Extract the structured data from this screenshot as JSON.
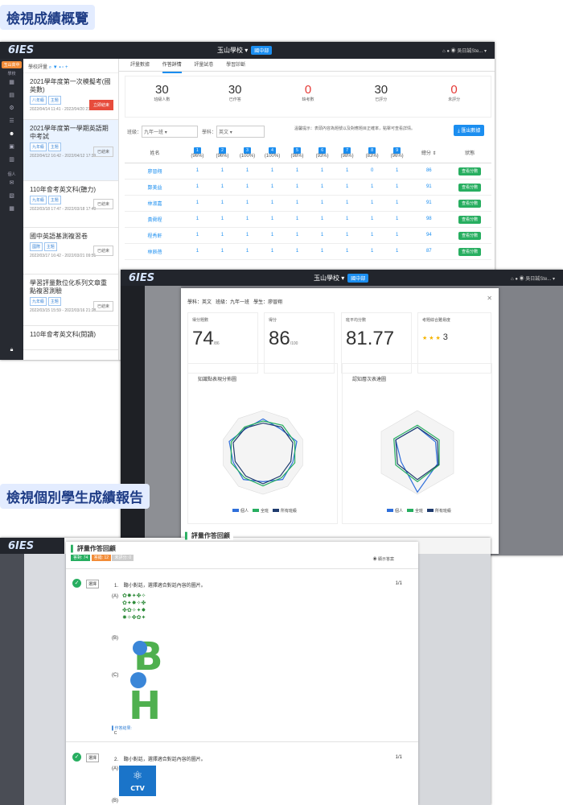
{
  "headings": {
    "overview": "檢視成績概覽",
    "report": "檢視個別學生成績報告"
  },
  "app": {
    "logo": "6IES",
    "school": "玉山學校",
    "dept": "國中部",
    "user": "吳日誠Ste..."
  },
  "sidebar": {
    "badge": "玉山高中",
    "school_label": "學校",
    "sub_badge": "個人",
    "icons": [
      "home-icon",
      "plan-icon",
      "settings-icon",
      "list-icon",
      "people-icon",
      "report-icon",
      "folder-icon",
      "chat-icon",
      "chart-icon",
      "grid-icon",
      "lock-icon"
    ]
  },
  "list": {
    "toolbar": "學校評量",
    "items": [
      {
        "title": "2021學年度第一次模擬考(國英數)",
        "tag1": "八年級",
        "tag2": "主題",
        "status": "立即結束",
        "time": "2022/04/14 11:41 - 2022/04/20 23:59",
        "red": true
      },
      {
        "title": "2021學年度第一學期英語期中考試",
        "tag1": "九年級",
        "tag2": "主題",
        "status": "已結束",
        "time": "2022/04/12 16:42 - 2022/04/12 17:39",
        "red": false
      },
      {
        "title": "110年會考英文科(聽力)",
        "tag1": "九年級",
        "tag2": "主題",
        "status": "已結束",
        "time": "2022/03/18 17:47 - 2022/03/18 17:49",
        "red": false
      },
      {
        "title": "國中英語基測複習卷",
        "tag1": "國際",
        "tag2": "主題",
        "status": "已結束",
        "time": "2022/03/17 16:42 - 2022/03/21 09:51",
        "red": false
      },
      {
        "title": "學習評量數位化系列文章重點複習測驗",
        "tag1": "九年級",
        "tag2": "主題",
        "status": "已結束",
        "time": "2022/03/15 15:59 - 2022/03/16 21:28",
        "red": false
      },
      {
        "title": "110年會考英文科(閱讀)",
        "tag1": "九年級",
        "tag2": "主題",
        "status": "",
        "time": "",
        "red": false
      }
    ]
  },
  "tabs": [
    "評量數據",
    "作答詳情",
    "評量試卷",
    "學習診斷"
  ],
  "summary": [
    {
      "v": "30",
      "l": "班級人數"
    },
    {
      "v": "30",
      "l": "已作答"
    },
    {
      "v": "0",
      "l": "缺考數"
    },
    {
      "v": "30",
      "l": "已評分"
    },
    {
      "v": "0",
      "l": "未評分"
    }
  ],
  "filter": {
    "class": "九年一班",
    "subject": "英文",
    "hint": "溫馨提示：表頭內容為題號以及對應題目正確率，點擊可查看詳情。",
    "export": "匯出數據",
    "class_label": "班級：",
    "subject_label": "學科："
  },
  "grades": {
    "name_header": "姓名",
    "score_header": "總分",
    "status_header": "狀態",
    "qs": [
      {
        "n": "1",
        "p": "(96%)"
      },
      {
        "n": "2",
        "p": "(96%)"
      },
      {
        "n": "3",
        "p": "(100%)"
      },
      {
        "n": "4",
        "p": "(100%)"
      },
      {
        "n": "5",
        "p": "(98%)"
      },
      {
        "n": "6",
        "p": "(93%)"
      },
      {
        "n": "7",
        "p": "(98%)"
      },
      {
        "n": "8",
        "p": "(83%)"
      },
      {
        "n": "9",
        "p": "(96%)"
      }
    ],
    "rows": [
      {
        "name": "廖晉翔",
        "s": [
          "1",
          "1",
          "1",
          "1",
          "1",
          "1",
          "1",
          "0",
          "1"
        ],
        "total": "86"
      },
      {
        "name": "鄭美益",
        "s": [
          "1",
          "1",
          "1",
          "1",
          "1",
          "1",
          "1",
          "1",
          "1"
        ],
        "total": "91"
      },
      {
        "name": "林淑嘉",
        "s": [
          "1",
          "1",
          "1",
          "1",
          "1",
          "1",
          "1",
          "1",
          "1"
        ],
        "total": "91"
      },
      {
        "name": "黃舜程",
        "s": [
          "1",
          "1",
          "1",
          "1",
          "1",
          "1",
          "1",
          "1",
          "1"
        ],
        "total": "98"
      },
      {
        "name": "程秀軒",
        "s": [
          "1",
          "1",
          "1",
          "1",
          "1",
          "1",
          "1",
          "1",
          "1"
        ],
        "total": "94"
      },
      {
        "name": "林辰蓓",
        "s": [
          "1",
          "1",
          "1",
          "1",
          "1",
          "1",
          "1",
          "1",
          "1"
        ],
        "total": "87"
      }
    ],
    "action": "查看分數"
  },
  "modal": {
    "subject": "學科：英文",
    "class": "班級：九年一班",
    "student": "學生：廖晉翔",
    "cards": [
      {
        "l": "得分題數",
        "v": "74",
        "s": "/86"
      },
      {
        "l": "得分",
        "v": "86",
        "s": "/100"
      },
      {
        "l": "班平均分數",
        "v": "81.77",
        "s": ""
      },
      {
        "l": "考題綜合難易度",
        "v": "3",
        "s": ""
      }
    ],
    "stars": "★ ★ ★",
    "radar1": "知識點表現分佈圖",
    "radar2": "認知層次表達圖",
    "legend": [
      "個人",
      "全班",
      "所有班級"
    ],
    "colors": [
      "#2f6fdb",
      "#27ae60",
      "#1f3b6e"
    ]
  },
  "review": {
    "title": "評量作答回顧",
    "correct": "答對: 74",
    "wrong": "答錯: 12",
    "ungraded": "未評分: 0",
    "toggle": "顯示答案",
    "q1": {
      "num": "1.",
      "text": "聽小對話，選擇適合對話內容的圖片。",
      "page": "1/1",
      "mark": "選擇",
      "opts": [
        "(A)",
        "(B)",
        "(C)"
      ],
      "ans_label": "作答結果:",
      "ans": "C"
    },
    "q2": {
      "num": "2.",
      "text": "聽小對話，選擇適合對話內容的圖片。",
      "page": "1/1",
      "mark": "選擇",
      "opts": [
        "(A)",
        "(B)"
      ],
      "logo": "CTV"
    }
  }
}
